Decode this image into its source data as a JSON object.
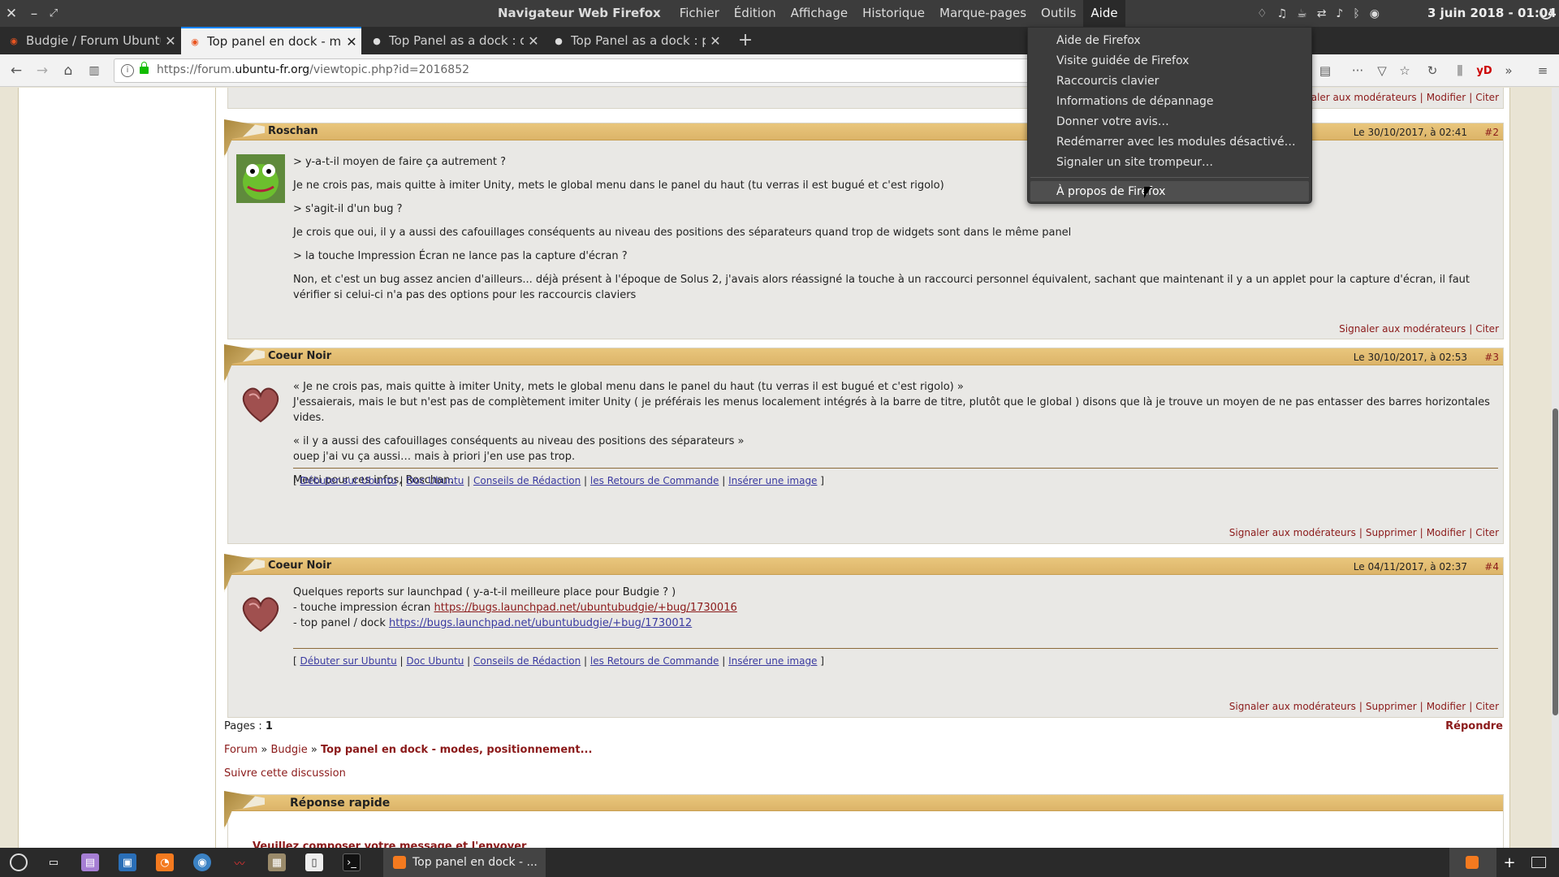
{
  "topbar": {
    "close": "✕",
    "minimize": "–",
    "restore": "⤢",
    "app_title": "Navigateur Web Firefox",
    "menus": [
      "Fichier",
      "Édition",
      "Affichage",
      "Historique",
      "Marque-pages",
      "Outils",
      "Aide"
    ],
    "active_menu_index": 6,
    "clock": "3 juin 2018 - 01:04"
  },
  "tabs": [
    {
      "title": "Budgie / Forum Ubuntu-fr",
      "active": false
    },
    {
      "title": "Top panel en dock - modes",
      "active": true
    },
    {
      "title": "Top Panel as a dock : disp",
      "active": false
    },
    {
      "title": "Top Panel as a dock : pre",
      "active": false
    }
  ],
  "tab_close": "✕",
  "tab_new": "+",
  "url": {
    "scheme": "https://forum.",
    "host": "ubuntu-fr.org",
    "path": "/viewtopic.php?id=2016852"
  },
  "help_menu": {
    "items": [
      "Aide de Firefox",
      "Visite guidée de Firefox",
      "Raccourcis clavier",
      "Informations de dépannage",
      "Donner votre avis…",
      "Redémarrer avec les modules désactivé…",
      "Signaler un site trompeur…"
    ],
    "about": "À propos de Firefox"
  },
  "top_actions": {
    "signal": "Signaler aux modérateurs",
    "modifier": "Modifier",
    "citer": "Citer"
  },
  "posts": [
    {
      "author": "Roschan",
      "date": "Le 30/10/2017, à 02:41",
      "num": "#2",
      "paragraphs": [
        "> y-a-t-il moyen de faire ça autrement ?",
        "Je ne crois pas, mais quitte à imiter Unity, mets le global menu dans le panel du haut (tu verras il est bugué et c'est rigolo)",
        "> s'agit-il d'un bug ?",
        "Je crois que oui, il y a aussi des cafouillages conséquents au niveau des positions des séparateurs quand trop de widgets sont dans le même panel",
        "> la touche Impression Écran ne lance pas la capture d'écran ?",
        "Non, et c'est un bug assez ancien d'ailleurs... déjà présent à l'époque de Solus 2, j'avais alors réassigné la touche à un raccourci personnel équivalent, sachant que maintenant il y a un applet pour la capture d'écran, il faut vérifier si celui-ci n'a pas des options pour les raccourcis claviers"
      ],
      "actions": [
        "Signaler aux modérateurs",
        "Citer"
      ]
    },
    {
      "author": "Coeur Noir",
      "date": "Le 30/10/2017, à 02:53",
      "num": "#3",
      "paragraphs": [
        "« Je ne crois pas, mais quitte à imiter Unity, mets le global menu dans le panel du haut (tu verras il est bugué et c'est rigolo) »",
        "J'essaierais, mais le but n'est pas de complètement imiter Unity ( je préférais les menus localement intégrés à la barre de titre, plutôt que le global ) disons que là je trouve un moyen de ne pas entasser des barres horizontales vides.",
        "« il y a aussi des cafouillages conséquents au niveau des positions des séparateurs »",
        "ouep j'ai vu ça aussi… mais à priori j'en use pas trop.",
        "Merci pour ces infos, Roschan."
      ],
      "actions": [
        "Signaler aux modérateurs",
        "Supprimer",
        "Modifier",
        "Citer"
      ]
    },
    {
      "author": "Coeur Noir",
      "date": "Le 04/11/2017, à 02:37",
      "num": "#4",
      "lines": [
        "Quelques reports sur launchpad ( y-a-t-il meilleure place pour Budgie ? )",
        "- touche impression écran ",
        "- top panel / dock "
      ],
      "links": [
        "https://bugs.launchpad.net/ubuntubudgie/+bug/1730016",
        "https://bugs.launchpad.net/ubuntubudgie/+bug/1730012"
      ],
      "actions": [
        "Signaler aux modérateurs",
        "Supprimer",
        "Modifier",
        "Citer"
      ]
    }
  ],
  "signature": {
    "open": "[ ",
    "close": " ]",
    "sep": " | ",
    "links": [
      "Débuter sur Ubuntu",
      "Doc Ubuntu",
      "Conseils de Rédaction",
      "les Retours de Commande",
      "Insérer une image"
    ]
  },
  "pages": {
    "label": "Pages : ",
    "current": "1"
  },
  "repondre": "Répondre",
  "breadcrumb": {
    "forum": "Forum",
    "sep": " » ",
    "budgie": "Budgie",
    "topic": "Top panel en dock - modes, positionnement..."
  },
  "suivre": "Suivre cette discussion",
  "quick_reply": {
    "title": "Réponse rapide",
    "sub": "Veuillez composer votre message et l'envoyer"
  },
  "taskbar": {
    "task_title": "Top panel en dock - ..."
  },
  "colors": {
    "accent": "#8b1a1a",
    "header_bar": "#e2bd73",
    "firefox_blue": "#0a84ff"
  }
}
